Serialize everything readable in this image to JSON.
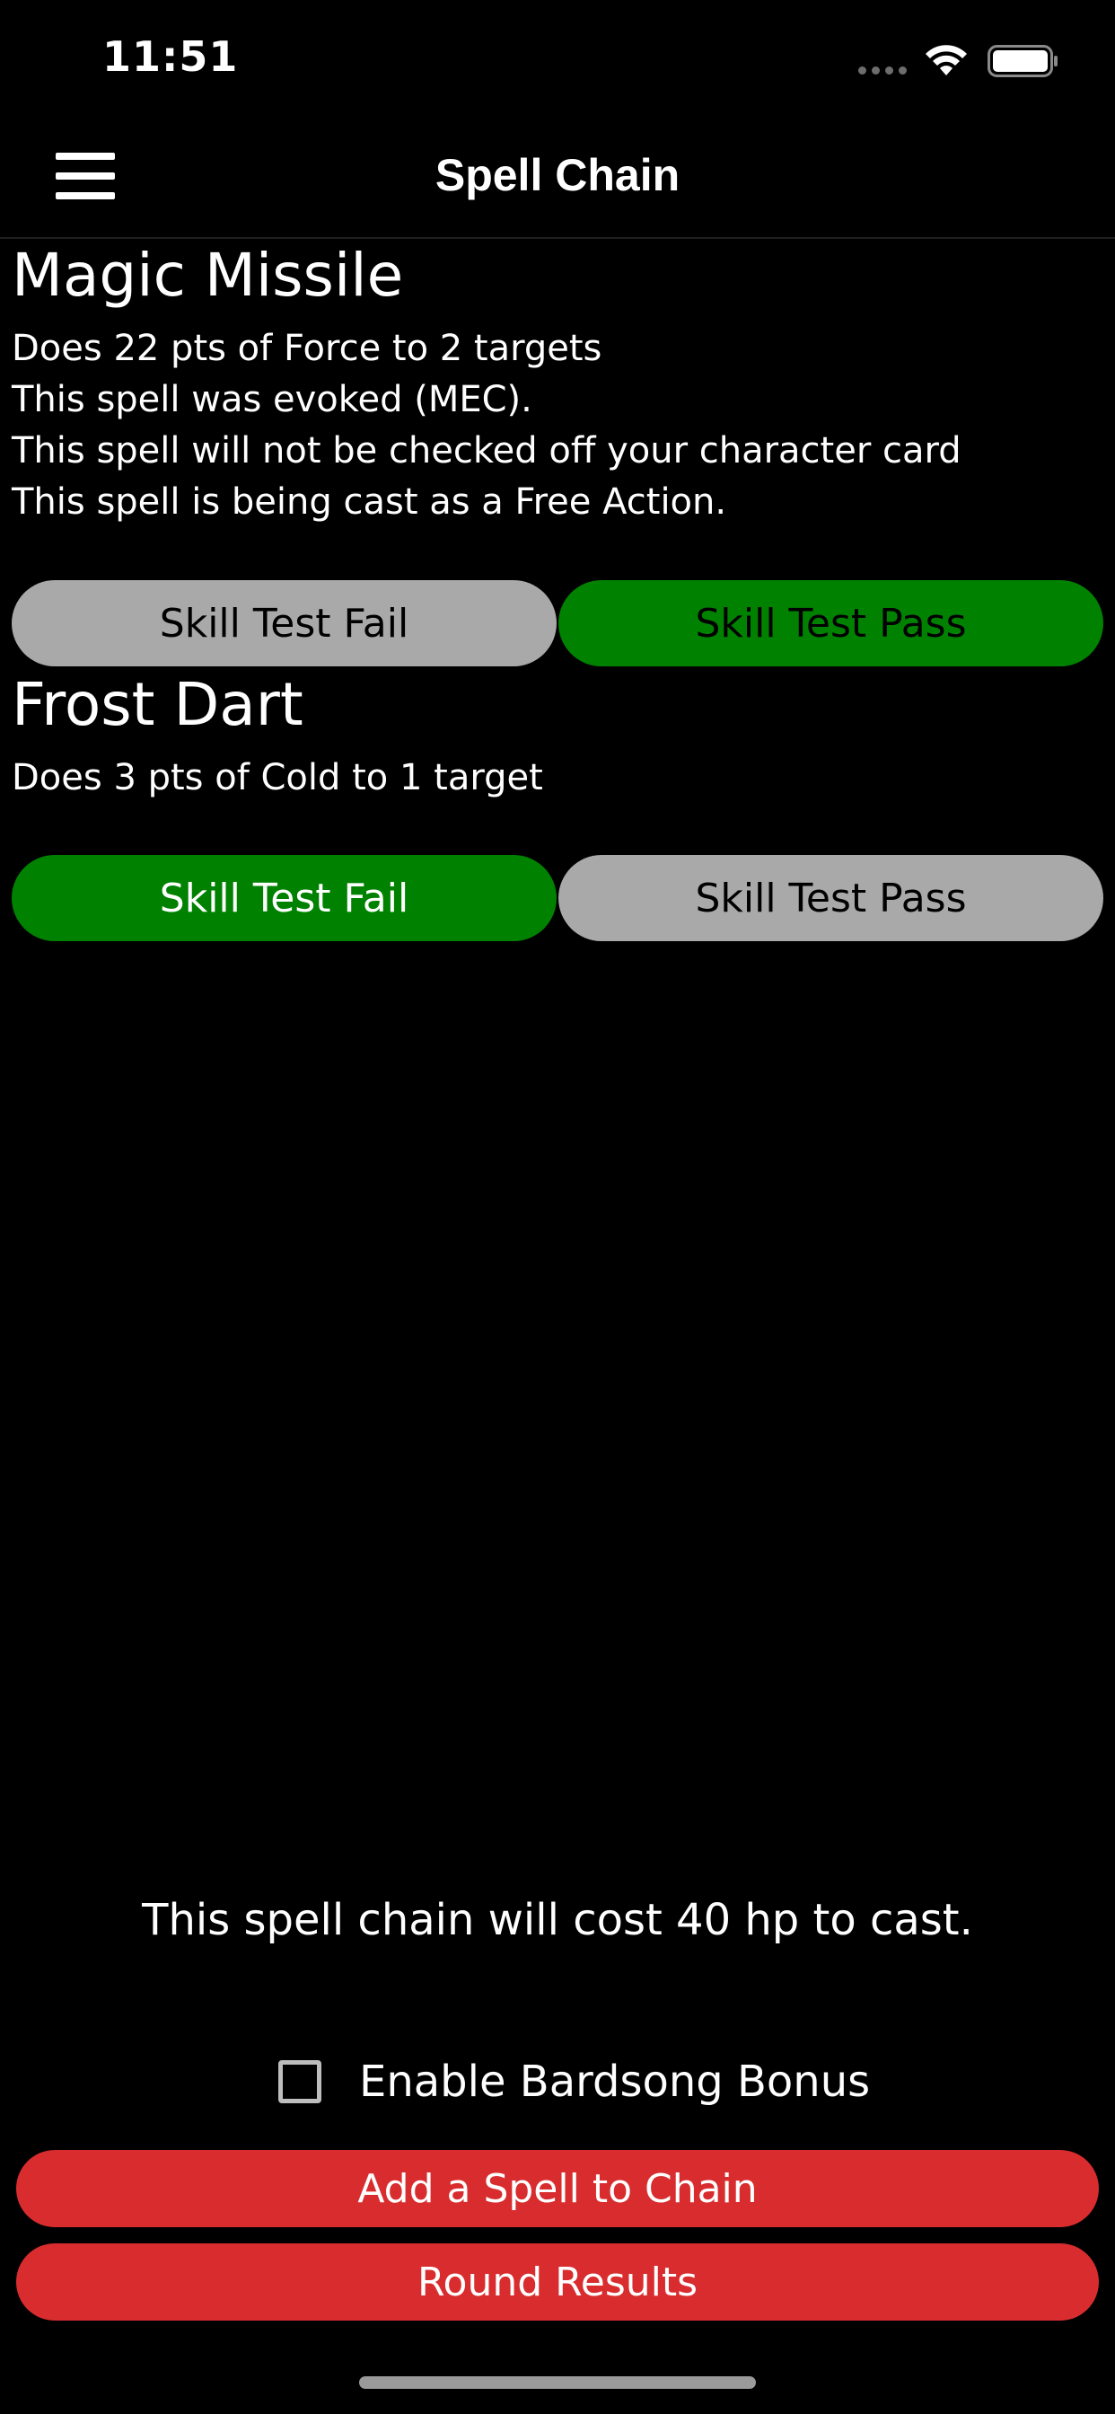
{
  "status_bar": {
    "time": "11:51"
  },
  "nav": {
    "title": "Spell Chain",
    "menu_icon": "hamburger-menu-icon"
  },
  "spells": [
    {
      "name": "Magic Missile",
      "description": [
        "Does 22 pts of Force to 2 targets",
        "This spell was evoked (MEC).",
        "This spell will not be checked off your character card",
        "This spell is being cast as a Free Action."
      ],
      "fail_label": "Skill Test Fail",
      "pass_label": "Skill Test Pass",
      "selected": "pass"
    },
    {
      "name": "Frost Dart",
      "description": [
        "Does 3 pts of Cold to 1 target"
      ],
      "fail_label": "Skill Test Fail",
      "pass_label": "Skill Test Pass",
      "selected": "fail"
    }
  ],
  "footer": {
    "cost_text": "This spell chain will cost 40 hp to cast.",
    "bardsong_label": "Enable Bardsong Bonus",
    "bardsong_checked": false,
    "add_spell_label": "Add a Spell to Chain",
    "round_results_label": "Round Results"
  },
  "colors": {
    "selected_green": "#008200",
    "unselected_grey": "#a9a9a9",
    "action_red": "#d92c2e",
    "background": "#000000"
  }
}
